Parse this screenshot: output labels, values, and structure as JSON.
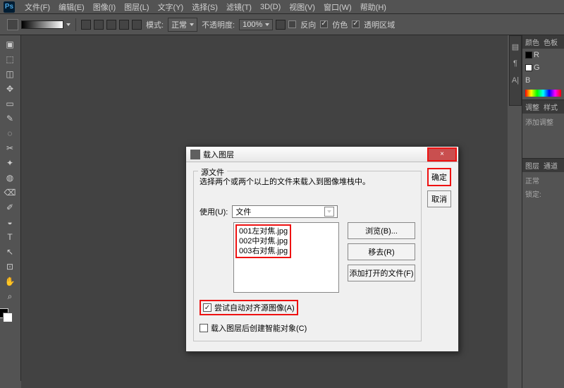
{
  "menu": {
    "items": [
      "文件(F)",
      "编辑(E)",
      "图像(I)",
      "图层(L)",
      "文字(Y)",
      "选择(S)",
      "滤镜(T)",
      "3D(D)",
      "视图(V)",
      "窗口(W)",
      "帮助(H)"
    ]
  },
  "optbar": {
    "mode_label": "模式:",
    "mode_value": "正常",
    "opacity_label": "不透明度:",
    "opacity_value": "100%",
    "reverse": "反向",
    "dither": "仿色",
    "transparency": "透明区域"
  },
  "tools": [
    "▣",
    "⬚",
    "◫",
    "✥",
    "▭",
    "✎",
    "◌",
    "✂",
    "✦",
    "◍",
    "⌫",
    "✐",
    "◒",
    "T",
    "↖",
    "⊡",
    "✋",
    "⌕"
  ],
  "right": {
    "color_tab": "颜色",
    "swatch_tab": "色板",
    "r": "R",
    "g": "G",
    "b": "B",
    "adjust_tab": "调整",
    "style_tab": "样式",
    "add_adjust": "添加调整",
    "layers_tab": "图层",
    "channels_tab": "通道",
    "normal": "正常",
    "lock": "锁定:",
    "icons": [
      "▤",
      "¶",
      "A|"
    ]
  },
  "dialog": {
    "title": "载入图层",
    "ok": "确定",
    "cancel": "取消",
    "sourceGroup": "源文件",
    "sourceDesc": "选择两个或两个以上的文件来载入到图像堆栈中。",
    "useLabel": "使用(U):",
    "useValue": "文件",
    "files": [
      "001左对焦.jpg",
      "002中对焦.jpg",
      "003右对焦.jpg"
    ],
    "browse": "浏览(B)...",
    "remove": "移去(R)",
    "addOpen": "添加打开的文件(F)",
    "autoAlign": "尝试自动对齐源图像(A)",
    "smartObj": "载入图层后创建智能对象(C)",
    "close": "×"
  }
}
